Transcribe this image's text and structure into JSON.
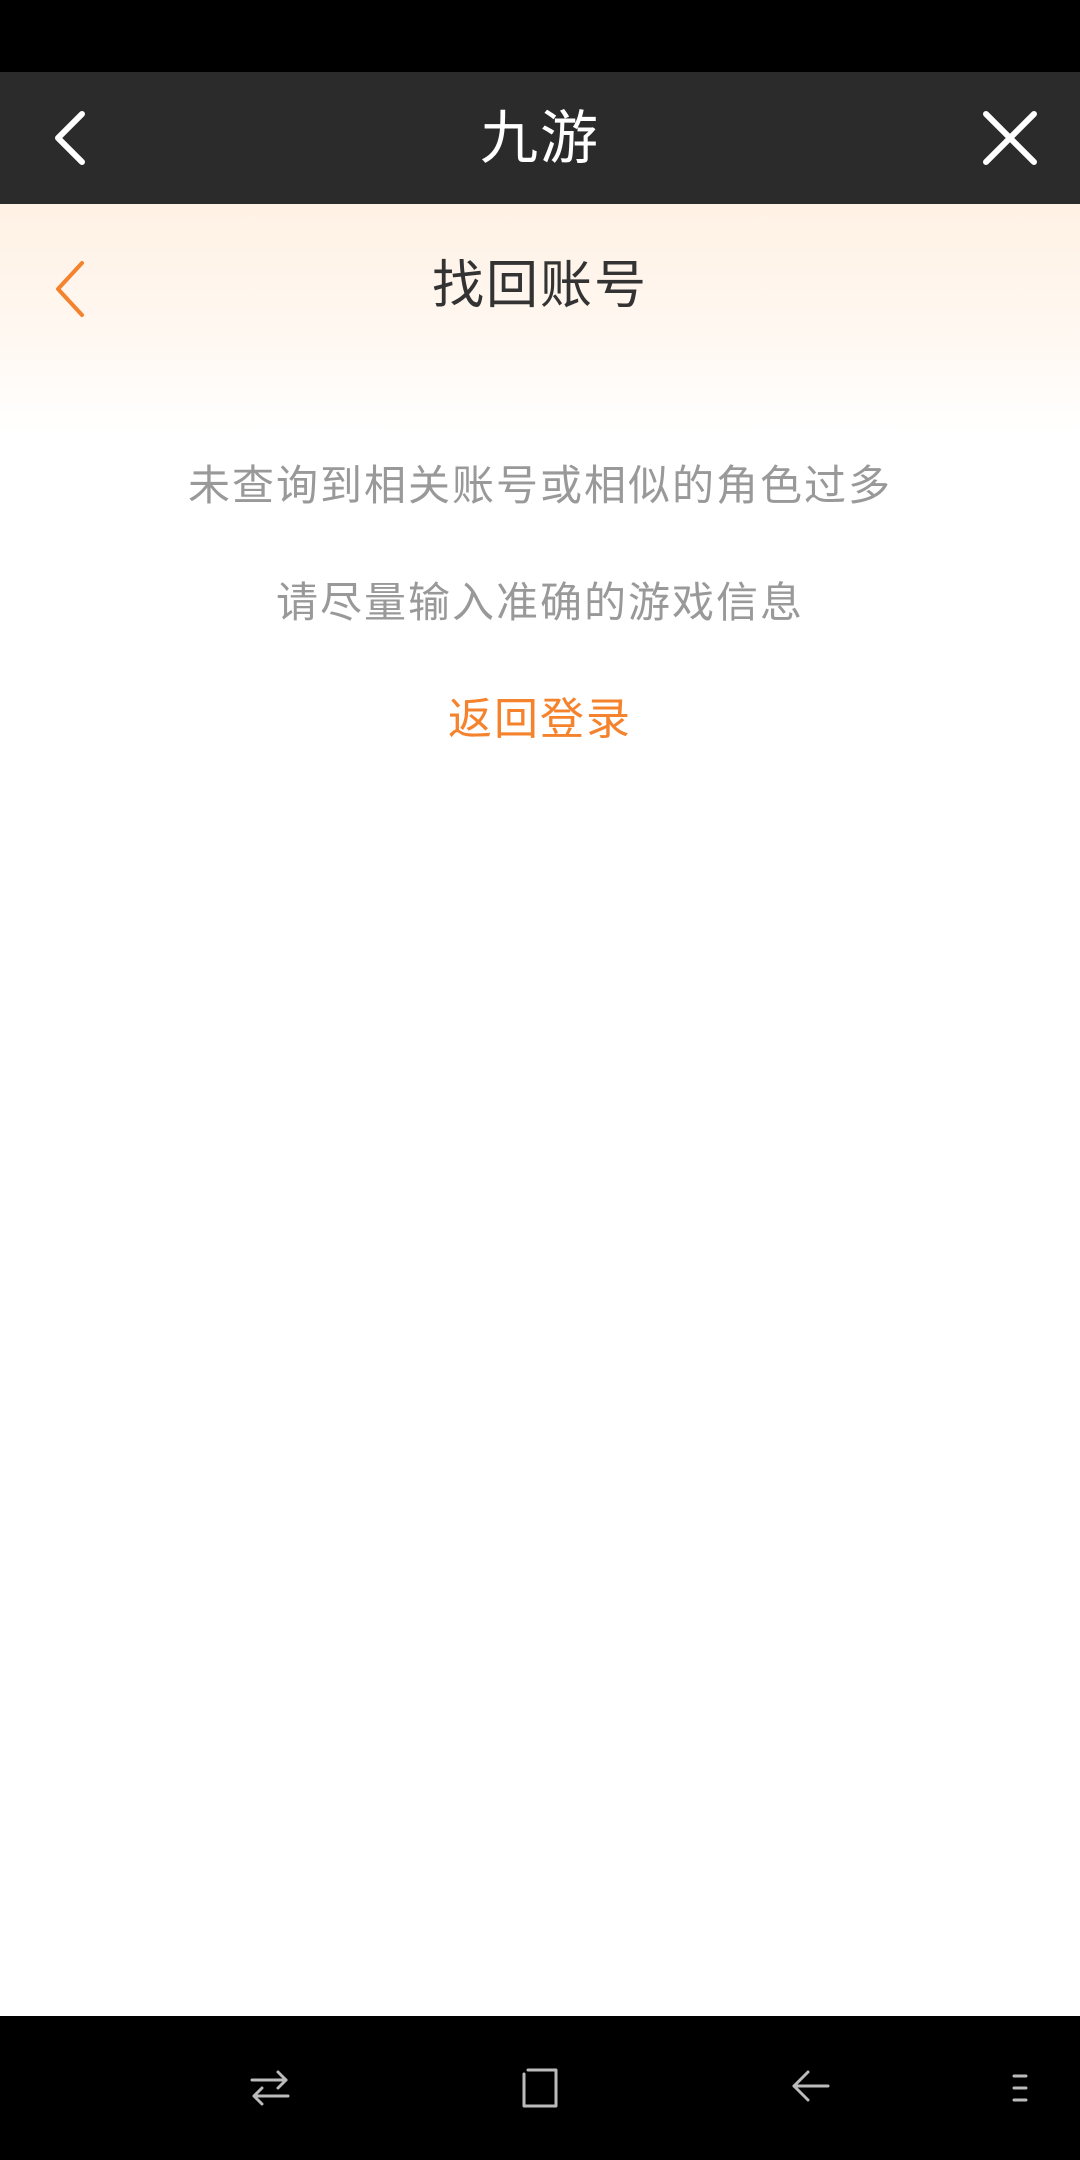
{
  "app_bar": {
    "title": "九游",
    "back_icon": "chevron-left-icon",
    "close_icon": "close-icon"
  },
  "page_header": {
    "title": "找回账号",
    "back_icon": "chevron-left-icon"
  },
  "content": {
    "message_line1": "未查询到相关账号或相似的角色过多",
    "message_line2": "请尽量输入准确的游戏信息",
    "return_login_label": "返回登录"
  },
  "nav_bar": {
    "icons": [
      "recent-apps-icon",
      "home-icon",
      "back-icon",
      "menu-icon"
    ]
  },
  "colors": {
    "accent": "#f5822d",
    "app_bar": "#2b2b2b",
    "message_text": "#999999",
    "title_text": "#333333"
  }
}
